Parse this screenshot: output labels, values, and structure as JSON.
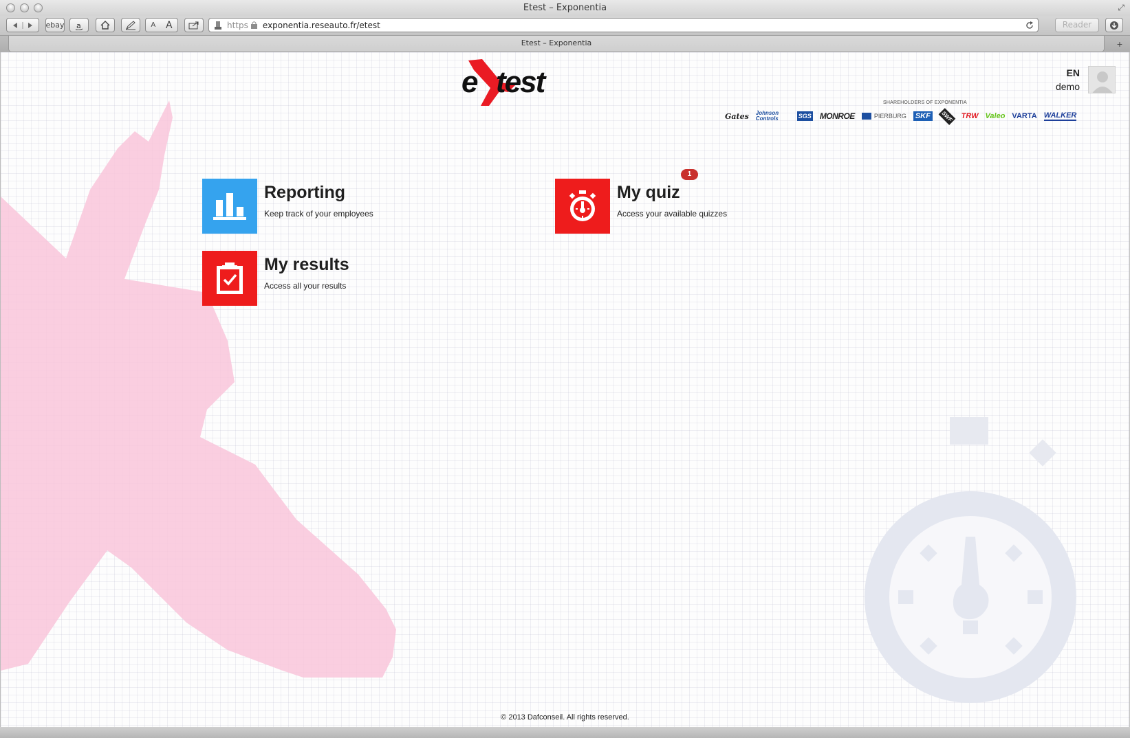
{
  "browser": {
    "window_title": "Etest – Exponentia",
    "tab_title": "Etest – Exponentia",
    "toolbar": {
      "ebay_label": "ebay",
      "font_smaller": "A",
      "font_larger": "A",
      "reader_label": "Reader"
    },
    "url": {
      "protocol": "https",
      "address": "exponentia.reseauto.fr/etest"
    }
  },
  "header": {
    "logo_text": "eXtest",
    "language": "EN",
    "username": "demo",
    "shareholders_label": "SHAREHOLDERS OF EXPONENTIA",
    "brands": [
      "Gates",
      "Johnson Controls",
      "SGS",
      "MONROE",
      "PIERBURG",
      "SKF",
      "SWF",
      "TRW",
      "Valeo",
      "VARTA",
      "WALKER"
    ]
  },
  "tiles": [
    {
      "title": "Reporting",
      "subtitle": "Keep track of your employees",
      "color": "#35a3ee",
      "icon": "bar-chart-icon"
    },
    {
      "title": "My quiz",
      "subtitle": "Access your available quizzes",
      "color": "#ee1c1c",
      "icon": "stopwatch-icon",
      "badge": "1"
    },
    {
      "title": "My results",
      "subtitle": "Access all your results",
      "color": "#ee1c1c",
      "icon": "clipboard-check-icon"
    }
  ],
  "footer": {
    "copyright": "© 2013 Dafconseil. All rights reserved."
  },
  "colors": {
    "accent_blue": "#35a3ee",
    "accent_red": "#ee1c1c",
    "badge_red": "#c9302c"
  }
}
